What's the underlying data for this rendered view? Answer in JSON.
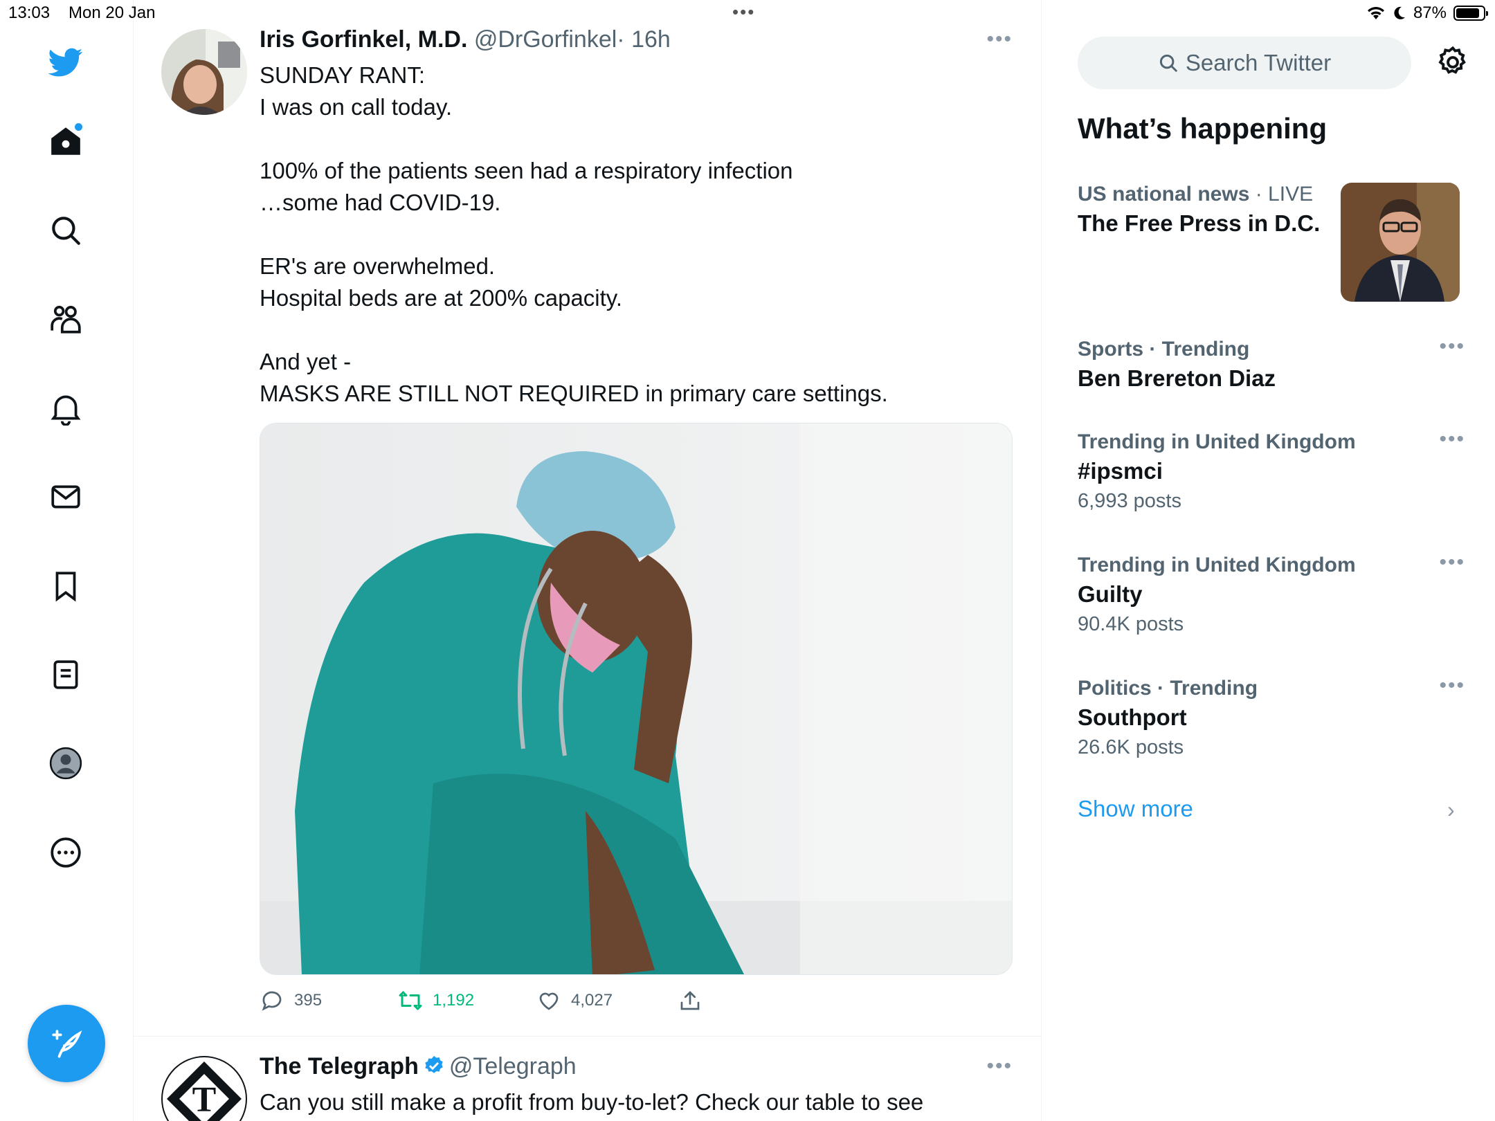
{
  "status_bar": {
    "time": "13:03",
    "date": "Mon 20 Jan",
    "battery": "87%",
    "battery_level": 0.87
  },
  "nav": {
    "items": [
      {
        "icon": "twitter-logo-icon"
      },
      {
        "icon": "home-icon"
      },
      {
        "icon": "search-icon"
      },
      {
        "icon": "communities-icon"
      },
      {
        "icon": "notifications-icon"
      },
      {
        "icon": "messages-icon"
      },
      {
        "icon": "bookmarks-icon"
      },
      {
        "icon": "lists-icon"
      },
      {
        "icon": "profile-icon"
      },
      {
        "icon": "more-icon"
      }
    ],
    "compose_icon": "compose-icon"
  },
  "tweets": [
    {
      "name": "Iris Gorfinkel, M.D.",
      "handle": "@DrGorfinkel",
      "time": "· 16h",
      "more": "•••",
      "text": "SUNDAY RANT:\nI was on call today.\n\n100% of the patients  seen had a respiratory infection\n …some had COVID-19.\n\nER's are  overwhelmed.\nHospital beds are at 200% capacity.\n\nAnd yet -\nMASKS ARE STILL NOT REQUIRED  in  primary care settings.",
      "replies": "395",
      "retweets": "1,192",
      "likes": "4,027"
    },
    {
      "name": "The Telegraph",
      "handle": "@Telegraph",
      "more": "•••",
      "text": "Can you still make a profit from buy-to-let? Check our table to see"
    }
  ],
  "sidebar": {
    "search_placeholder": "Search Twitter",
    "whats_happening": "What’s happening",
    "trends": [
      {
        "meta": "US national news",
        "live": " · LIVE",
        "title": "The Free Press in D.C."
      },
      {
        "meta": "Sports · Trending",
        "title": "Ben Brereton Diaz",
        "more": "•••"
      },
      {
        "meta": "Trending in United Kingdom",
        "title": "#ipsmci",
        "count": "6,993 posts",
        "more": "•••"
      },
      {
        "meta": "Trending in United Kingdom",
        "title": "Guilty",
        "count": "90.4K posts",
        "more": "•••"
      },
      {
        "meta": "Politics · Trending",
        "title": "Southport",
        "count": "26.6K posts",
        "more": "•••"
      }
    ],
    "show_more": "Show more"
  },
  "colors": {
    "accent": "#1d9bf0",
    "retweet": "#00ba7c",
    "secondary_text": "#536471"
  }
}
